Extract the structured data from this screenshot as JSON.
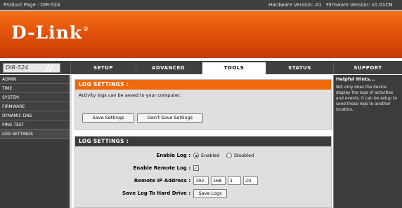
{
  "topbar": {
    "product": "Product Page : DIR-524",
    "hardware": "Hardware Version: A1",
    "firmware": "Firmware Version: v1.01CN"
  },
  "brand": {
    "logo": "D-Link",
    "tm": "®"
  },
  "model": {
    "name": "DIR-524",
    "slash": "//"
  },
  "tabs": [
    {
      "label": "SETUP"
    },
    {
      "label": "ADVANCED"
    },
    {
      "label": "TOOLS"
    },
    {
      "label": "STATUS"
    },
    {
      "label": "SUPPORT"
    }
  ],
  "sidebar": {
    "items": [
      {
        "label": "ADMIN"
      },
      {
        "label": "TIME"
      },
      {
        "label": "SYSTEM"
      },
      {
        "label": "FIRMWARE"
      },
      {
        "label": "DYNAMIC DNS"
      },
      {
        "label": "PING TEST"
      },
      {
        "label": "LOG SETTINGS"
      }
    ]
  },
  "panel1": {
    "title": "LOG SETTINGS :",
    "description": "Activity logs can be saved to your computer.",
    "save_label": "Save Settings",
    "dont_save_label": "Don't Save Settings"
  },
  "panel2": {
    "title": "LOG SETTINGS :",
    "enable_log_label": "Enable Log :",
    "enabled_label": "Enabled",
    "disabled_label": "Disabled",
    "enable_remote_label": "Enable Remote Log :",
    "remote_ip_label": "Remote IP Address :",
    "ip": [
      "192",
      "168",
      "1",
      "20"
    ],
    "save_hd_label": "Save Log To Hard Drive :",
    "save_logs_label": "Save Logs"
  },
  "help": {
    "title": "Helpful Hints...",
    "text": "Not only does the device display the logs of activities and events, it can be setup to send these logs to another location."
  }
}
